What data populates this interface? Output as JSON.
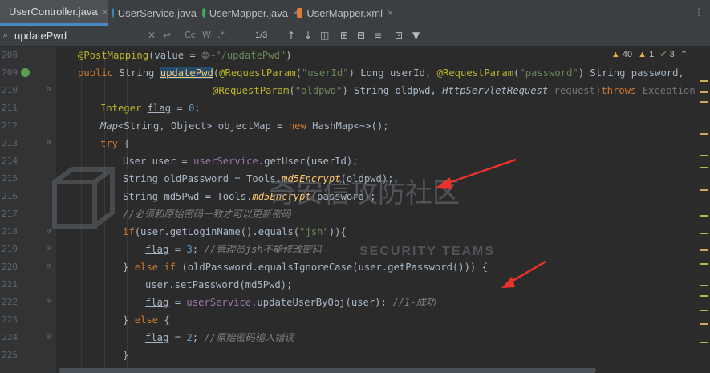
{
  "tabs": [
    {
      "label": "UserController.java",
      "close": "×"
    },
    {
      "label": "UserService.java",
      "close": "×"
    },
    {
      "label": "UserMapper.java",
      "close": "×"
    },
    {
      "label": "UserMapper.xml",
      "close": "×"
    }
  ],
  "search": {
    "value": "updatePwd",
    "match_count": "1/3",
    "match_case": "Cc",
    "words": "W",
    "regex": ".*"
  },
  "inspection": {
    "warnings": "40",
    "weak": "1",
    "ok": "3"
  },
  "line_numbers": [
    "208",
    "209",
    "210",
    "211",
    "212",
    "213",
    "214",
    "215",
    "216",
    "217",
    "218",
    "219",
    "220",
    "221",
    "222",
    "223",
    "224",
    "225"
  ],
  "code": {
    "l208_ann": "@PostMapping",
    "l208_rest": "(value = ",
    "l208_str": "\"/updatePwd\"",
    "l208_end": ")",
    "l209_pub": "public ",
    "l209_type": "String ",
    "l209_name": "updatePwd",
    "l209_a": "(",
    "l209_ann1": "@RequestParam",
    "l209_b": "(",
    "l209_s1": "\"userId\"",
    "l209_c": ") Long userId, ",
    "l209_ann2": "@RequestParam",
    "l209_d": "(",
    "l209_s2": "\"password\"",
    "l209_e": ") String password,",
    "l210_ann": "@RequestParam",
    "l210_a": "(",
    "l210_s": "\"oldpwd\"",
    "l210_b": ") String oldpwd, ",
    "l210_type": "HttpServletRequest",
    "l210_c": " request)",
    "l210_kw": "throws ",
    "l210_d": "Exception {",
    "l211_type": "Integer ",
    "l211_var": "flag",
    "l211_a": " = ",
    "l211_num": "0",
    "l211_b": ";",
    "l212_a": "Map",
    "l212_b": "<String, Object> objectMap = ",
    "l212_kw": "new ",
    "l212_c": "HashMap<~>();",
    "l213_kw": "try ",
    "l213_a": "{",
    "l214_a": "User user = ",
    "l214_fld": "userService",
    "l214_b": ".getUser(userId);",
    "l215_a": "String oldPassword = Tools.",
    "l215_st": "md5Encrypt",
    "l215_b": "(oldpwd);",
    "l216_a": "String md5Pwd = Tools.",
    "l216_st": "md5Encrypt",
    "l216_b": "(password);",
    "l217_cmt": "//必须和原始密码一致才可以更新密码",
    "l218_kw": "if",
    "l218_a": "(user.getLoginName().equals(",
    "l218_s": "\"jsh\"",
    "l218_b": ")){",
    "l219_var": "flag",
    "l219_a": " = ",
    "l219_num": "3",
    "l219_b": "; ",
    "l219_cmt": "//管理员jsh不能修改密码",
    "l220_a": "} ",
    "l220_kw": "else if ",
    "l220_b": "(oldPassword.equalsIgnoreCase(user.getPassword())) {",
    "l221_a": "user.setPassword(md5Pwd);",
    "l222_var": "flag",
    "l222_a": " = ",
    "l222_fld": "userService",
    "l222_b": ".updateUserByObj(user); ",
    "l222_cmt": "//1-成功",
    "l223_a": "} ",
    "l223_kw": "else ",
    "l223_b": "{",
    "l224_var": "flag",
    "l224_a": " = ",
    "l224_num": "2",
    "l224_b": "; ",
    "l224_cmt": "//原始密码输入错误",
    "l225_a": "}"
  },
  "watermark": {
    "cn": "奇安信攻防社区",
    "en": "SECURITY TEAMS"
  },
  "colors": {
    "arrow": "#e8322a",
    "background": "#2b2b2b",
    "tab_active_underline": "#4a88c7"
  }
}
